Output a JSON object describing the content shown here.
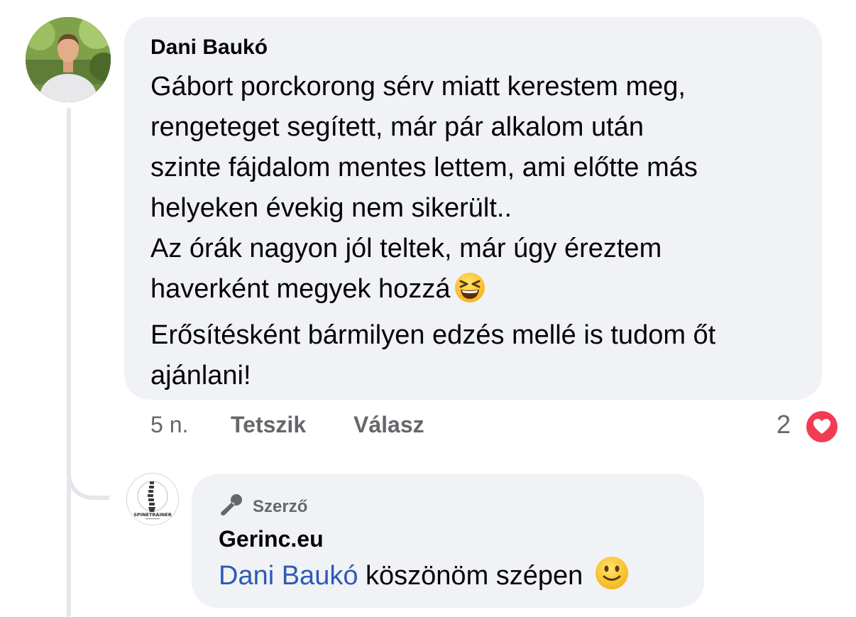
{
  "comment": {
    "author": "Dani Baukó",
    "lines": [
      "Gábort porckorong sérv miatt kerestem meg,",
      "rengeteget segített, már pár alkalom után",
      "szinte fájdalom mentes lettem, ami előtte más",
      "helyeken évekig nem sikerült..",
      "Az órák nagyon jól teltek, már úgy éreztem",
      "haverként megyek hozzá",
      "Erősítésként bármilyen edzés mellé is tudom őt",
      "ajánlani!"
    ],
    "emoji": "grinning-squinting-face-icon",
    "time": "5 n.",
    "like_label": "Tetszik",
    "reply_label": "Válasz",
    "reaction_count": "2",
    "reaction_icon": "heart-icon"
  },
  "reply": {
    "badge_label": "Szerző",
    "badge_icon": "microphone-icon",
    "author": "Gerinc.eu",
    "mention": "Dani Baukó",
    "text": "köszönöm szépen",
    "emoji": "slightly-smiling-face-icon",
    "avatar_logo_text": "SPINE TRAINER"
  },
  "colors": {
    "bubble": "#f0f2f5",
    "secondary_text": "#65676b",
    "mention": "#2f5ab5",
    "heart": "#f23c54"
  }
}
